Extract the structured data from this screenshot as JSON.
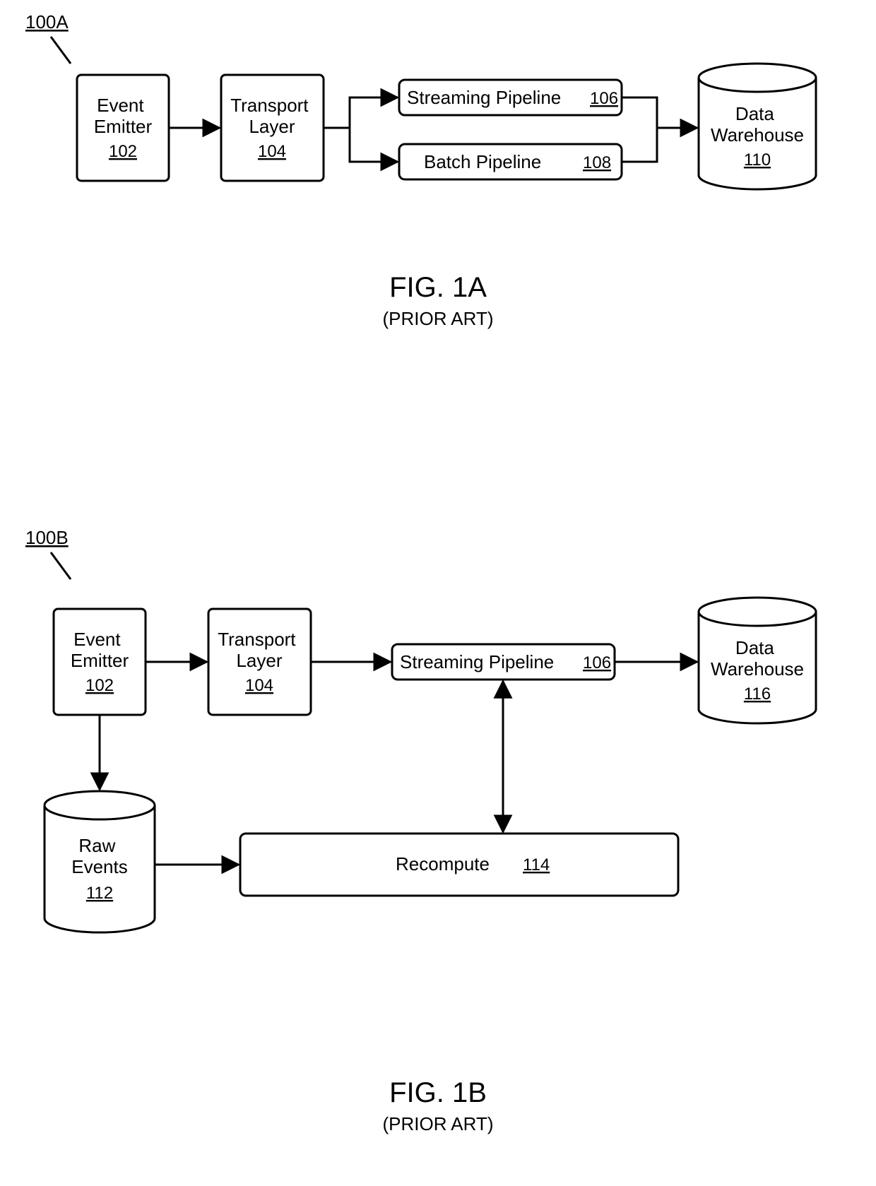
{
  "figA": {
    "ref": "100A",
    "caption": "FIG. 1A",
    "subcaption": "(PRIOR ART)",
    "nodes": {
      "event_emitter": {
        "label": "Event Emitter",
        "num": "102"
      },
      "transport": {
        "label": "Transport Layer",
        "num": "104"
      },
      "streaming": {
        "label": "Streaming Pipeline",
        "num": "106"
      },
      "batch": {
        "label": "Batch Pipeline",
        "num": "108"
      },
      "warehouse": {
        "label": "Data Warehouse",
        "num": "110"
      }
    }
  },
  "figB": {
    "ref": "100B",
    "caption": "FIG. 1B",
    "subcaption": "(PRIOR ART)",
    "nodes": {
      "event_emitter": {
        "label": "Event Emitter",
        "num": "102"
      },
      "transport": {
        "label": "Transport Layer",
        "num": "104"
      },
      "streaming": {
        "label": "Streaming Pipeline",
        "num": "106"
      },
      "raw_events": {
        "label": "Raw Events",
        "num": "112"
      },
      "recompute": {
        "label": "Recompute",
        "num": "114"
      },
      "warehouse": {
        "label": "Data Warehouse",
        "num": "116"
      }
    }
  }
}
